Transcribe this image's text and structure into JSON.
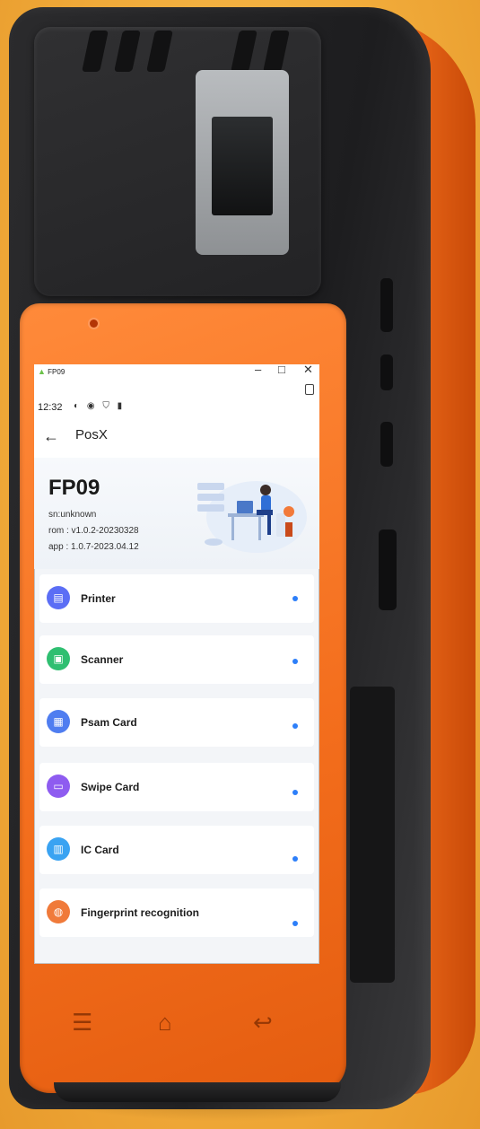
{
  "window": {
    "app_name": "FP09",
    "minimize": "–",
    "maximize": "□",
    "close": "✕"
  },
  "statusbar": {
    "time": "12:32",
    "icons": "◐ ◉ ⛉ ▮"
  },
  "appbar": {
    "back": "←",
    "title": "PosX"
  },
  "device_info": {
    "name": "FP09",
    "sn": "sn:unknown",
    "rom": "rom : v1.0.2-20230328",
    "app": "app : 1.0.7-2023.04.12"
  },
  "menu": [
    {
      "label": "Printer",
      "icon": "printer-icon",
      "color": "#5b6ef5"
    },
    {
      "label": "Scanner",
      "icon": "scanner-icon",
      "color": "#2fbf71"
    },
    {
      "label": "Psam Card",
      "icon": "psam-card-icon",
      "color": "#4f7df0"
    },
    {
      "label": "Swipe Card",
      "icon": "swipe-card-icon",
      "color": "#8e5cf0"
    },
    {
      "label": "IC Card",
      "icon": "ic-card-icon",
      "color": "#3aa3f2"
    },
    {
      "label": "Fingerprint recognition",
      "icon": "fingerprint-icon",
      "color": "#f07a3a"
    }
  ],
  "navkeys": {
    "menu": "☰",
    "home": "⌂",
    "back": "↩"
  },
  "colors": {
    "background": "#f2ad3c",
    "bezel": "#f36d1c",
    "status_dot": "#2d7ff9"
  }
}
